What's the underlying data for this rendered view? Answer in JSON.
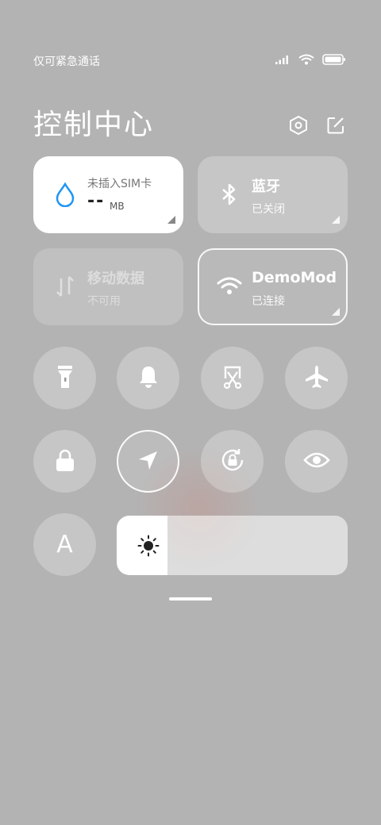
{
  "status_bar": {
    "carrier": "仅可紧急通话",
    "signal_icon": "signal-bars-icon",
    "wifi_icon": "wifi-icon",
    "battery_icon": "battery-icon"
  },
  "header": {
    "title": "控制中心",
    "settings_icon": "settings-hex-icon",
    "edit_icon": "edit-icon"
  },
  "tiles": {
    "data_usage": {
      "label": "未插入SIM卡",
      "value": "--",
      "unit": "MB",
      "icon": "water-drop-icon"
    },
    "bluetooth": {
      "title": "蓝牙",
      "status": "已关闭",
      "icon": "bluetooth-icon"
    },
    "mobile_data": {
      "title": "移动数据",
      "status": "不可用",
      "icon": "data-arrows-icon"
    },
    "wifi": {
      "title": "DemoMode",
      "status": "已连接",
      "icon": "wifi-icon"
    }
  },
  "toggles": [
    {
      "name": "flashlight",
      "icon": "flashlight-icon",
      "active": false
    },
    {
      "name": "ring",
      "icon": "bell-icon",
      "active": false
    },
    {
      "name": "screenshot",
      "icon": "scissors-icon",
      "active": false
    },
    {
      "name": "airplane",
      "icon": "airplane-icon",
      "active": false
    },
    {
      "name": "lock-screen",
      "icon": "lock-icon",
      "active": false
    },
    {
      "name": "location",
      "icon": "location-arrow-icon",
      "active": true
    },
    {
      "name": "rotation-lock",
      "icon": "rotation-lock-icon",
      "active": false
    },
    {
      "name": "reading-mode",
      "icon": "eye-icon",
      "active": false
    }
  ],
  "auto_brightness": {
    "label": "A"
  },
  "brightness": {
    "level": 0.22,
    "icon": "sun-icon"
  },
  "colors": {
    "tile_active": "#ffffff",
    "data_icon": "#2196f3",
    "background": "#b3b3b3"
  }
}
